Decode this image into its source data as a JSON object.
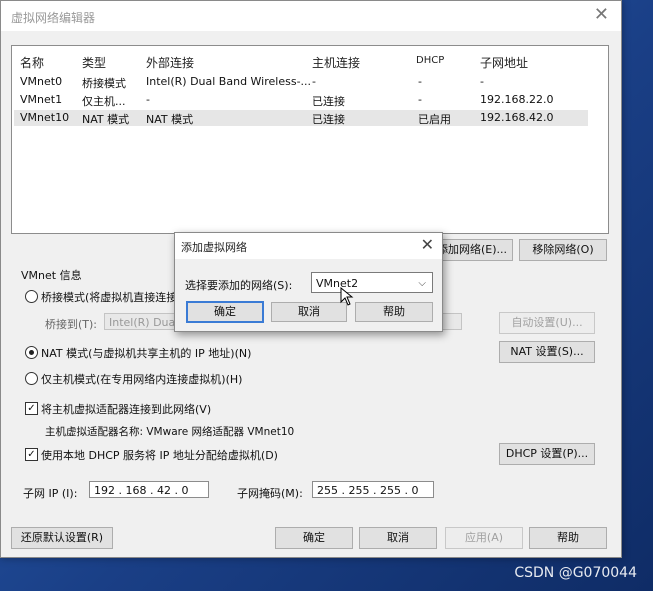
{
  "window": {
    "title": "虚拟网络编辑器",
    "close": "✕"
  },
  "table": {
    "headers": [
      "名称",
      "类型",
      "外部连接",
      "主机连接",
      "DHCP",
      "子网地址"
    ],
    "rows": [
      [
        "VMnet0",
        "桥接模式",
        "Intel(R) Dual Band Wireless-...",
        "-",
        "-",
        "-"
      ],
      [
        "VMnet1",
        "仅主机...",
        "-",
        "已连接",
        "-",
        "192.168.22.0"
      ],
      [
        "VMnet10",
        "NAT 模式",
        "NAT 模式",
        "已连接",
        "已启用",
        "192.168.42.0"
      ]
    ]
  },
  "list_buttons": {
    "add": "添加网络(E)...",
    "remove": "移除网络(O)"
  },
  "info": {
    "group_label": "VMnet 信息",
    "bridged_label": "桥接模式(将虚拟机直接连接到外部网络)(B)",
    "bridge_to_label": "桥接到(T):",
    "bridge_to_value": "Intel(R) Dual Band Wireless-AC",
    "auto_settings": "自动设置(U)...",
    "nat_label": "NAT 模式(与虚拟机共享主机的 IP 地址)(N)",
    "nat_settings": "NAT 设置(S)...",
    "hostonly_label": "仅主机模式(在专用网络内连接虚拟机)(H)",
    "connect_adapter_label": "将主机虚拟适配器连接到此网络(V)",
    "adapter_name_label": "主机虚拟适配器名称: VMware 网络适配器 VMnet10",
    "dhcp_label": "使用本地 DHCP 服务将 IP 地址分配给虚拟机(D)",
    "dhcp_settings": "DHCP 设置(P)...",
    "subnet_ip_label": "子网 IP (I):",
    "subnet_ip_value": "192 . 168 . 42 . 0",
    "subnet_mask_label": "子网掩码(M):",
    "subnet_mask_value": "255 . 255 . 255 . 0"
  },
  "footer": {
    "restore": "还原默认设置(R)",
    "ok": "确定",
    "cancel": "取消",
    "apply": "应用(A)",
    "help": "帮助"
  },
  "dialog": {
    "title": "添加虚拟网络",
    "close": "✕",
    "select_label": "选择要添加的网络(S):",
    "select_value": "VMnet2",
    "ok": "确定",
    "cancel": "取消",
    "help": "帮助"
  },
  "watermark": "CSDN @G070044",
  "colors": {
    "default_button_border": "#3a7bd5",
    "desktop": "#1f4f9c"
  }
}
